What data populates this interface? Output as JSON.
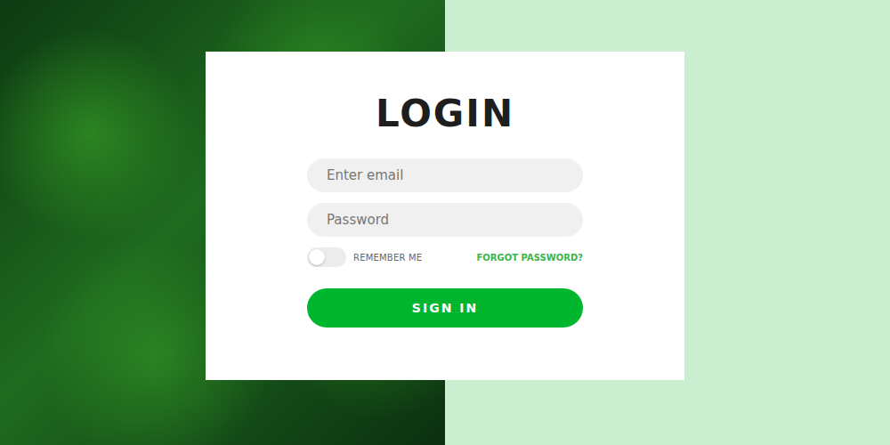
{
  "title": "LOGIN",
  "fields": [
    {
      "name": "email",
      "placeholder": "Enter email",
      "type": "email"
    },
    {
      "name": "password",
      "placeholder": "Password",
      "type": "password"
    }
  ],
  "remember": {
    "label": "REMEMBER ME",
    "on": false
  },
  "forgot": {
    "label": "FORGOT PASSWORD?"
  },
  "submit": {
    "label": "SIGN IN"
  }
}
